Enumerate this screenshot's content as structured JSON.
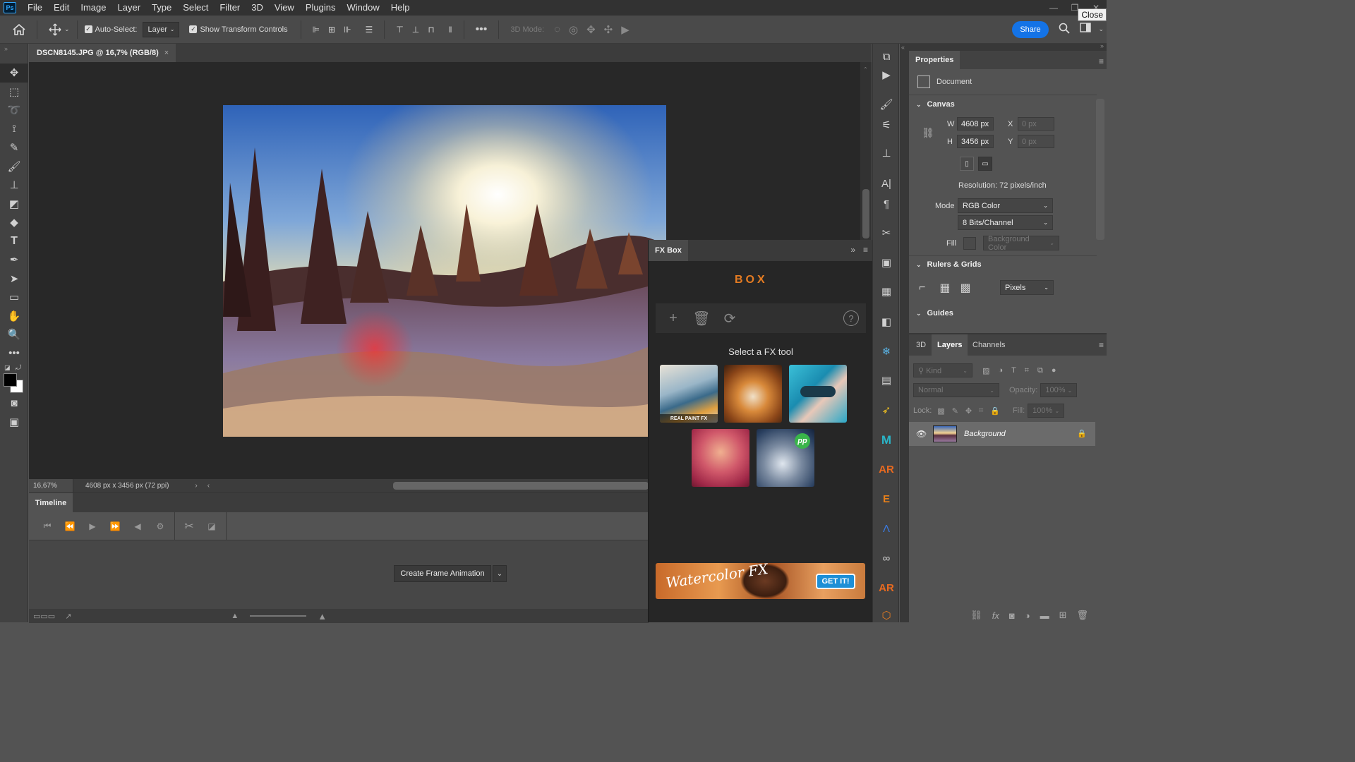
{
  "menubar": {
    "app_logo": "Ps",
    "items": [
      "File",
      "Edit",
      "Image",
      "Layer",
      "Type",
      "Select",
      "Filter",
      "3D",
      "View",
      "Plugins",
      "Window",
      "Help"
    ],
    "close_tooltip": "Close"
  },
  "options": {
    "auto_select_label": "Auto-Select:",
    "auto_select_value": "Layer",
    "transform_label": "Show Transform Controls",
    "mode3d_label": "3D Mode:",
    "share_label": "Share"
  },
  "document": {
    "tab_title": "DSCN8145.JPG @ 16,7% (RGB/8)",
    "zoom": "16,67%",
    "size_info": "4608 px x 3456 px (72 ppi)"
  },
  "timeline": {
    "tab": "Timeline",
    "create_button": "Create Frame Animation"
  },
  "fxbox": {
    "title": "FX Box",
    "logo": "BOX",
    "select_label": "Select a FX tool",
    "thumb1_caption": "REAL PAINT FX",
    "thumb5_badge": "pp",
    "banner_text": "Watercolor FX",
    "banner_button": "GET IT!"
  },
  "properties": {
    "tab": "Properties",
    "doc_label": "Document",
    "canvas_head": "Canvas",
    "w_label": "W",
    "w_value": "4608 px",
    "h_label": "H",
    "h_value": "3456 px",
    "x_label": "X",
    "x_placeholder": "0 px",
    "y_label": "Y",
    "y_placeholder": "0 px",
    "resolution": "Resolution: 72 pixels/inch",
    "mode_label": "Mode",
    "mode_value": "RGB Color",
    "bits_value": "8 Bits/Channel",
    "fill_label": "Fill",
    "fill_value": "Background Color",
    "rulers_head": "Rulers & Grids",
    "units_value": "Pixels",
    "guides_head": "Guides"
  },
  "layers": {
    "tabs": [
      "3D",
      "Layers",
      "Channels"
    ],
    "kind_placeholder": "Kind",
    "blend_mode": "Normal",
    "opacity_label": "Opacity:",
    "opacity_value": "100%",
    "lock_label": "Lock:",
    "fill_label": "Fill:",
    "fill_value": "100%",
    "layer_name": "Background"
  },
  "colors": {
    "accent": "#1473e6",
    "fx_orange": "#e47b22",
    "panel_bg": "#535353",
    "canvas_bg": "#282828"
  }
}
